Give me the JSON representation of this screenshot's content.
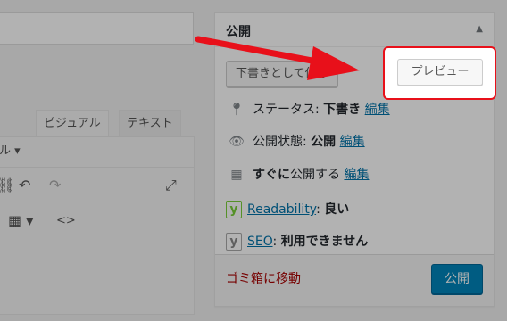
{
  "editor": {
    "tabs": [
      "ビジュアル",
      "テキスト"
    ],
    "format_select_tail": "ル ▾",
    "icons": [
      "redo-glyph-icon",
      "undo-icon",
      "redo-icon",
      "fullscreen-icon",
      "table-icon",
      "code-icon"
    ]
  },
  "publish": {
    "title": "公開",
    "save_draft_label": "下書きとして保存",
    "preview_label": "プレビュー",
    "status": {
      "label": "ステータス: ",
      "value": "下書き",
      "edit": "編集"
    },
    "visibility": {
      "label": "公開状態: ",
      "value": "公開",
      "edit": "編集"
    },
    "schedule": {
      "value": "すぐに",
      "label": "公開する",
      "edit": "編集"
    },
    "readability": {
      "label": "Readability",
      "sep": ": ",
      "value": "良い"
    },
    "seo": {
      "label": "SEO",
      "sep": ": ",
      "value": "利用できません"
    },
    "trash_label": "ゴミ箱に移動",
    "publish_label": "公開"
  },
  "colors": {
    "accent": "#0085ba",
    "highlight": "#e8101a",
    "trash": "#a00000",
    "link": "#0073aa",
    "yoast_good": "#7ad03a"
  }
}
